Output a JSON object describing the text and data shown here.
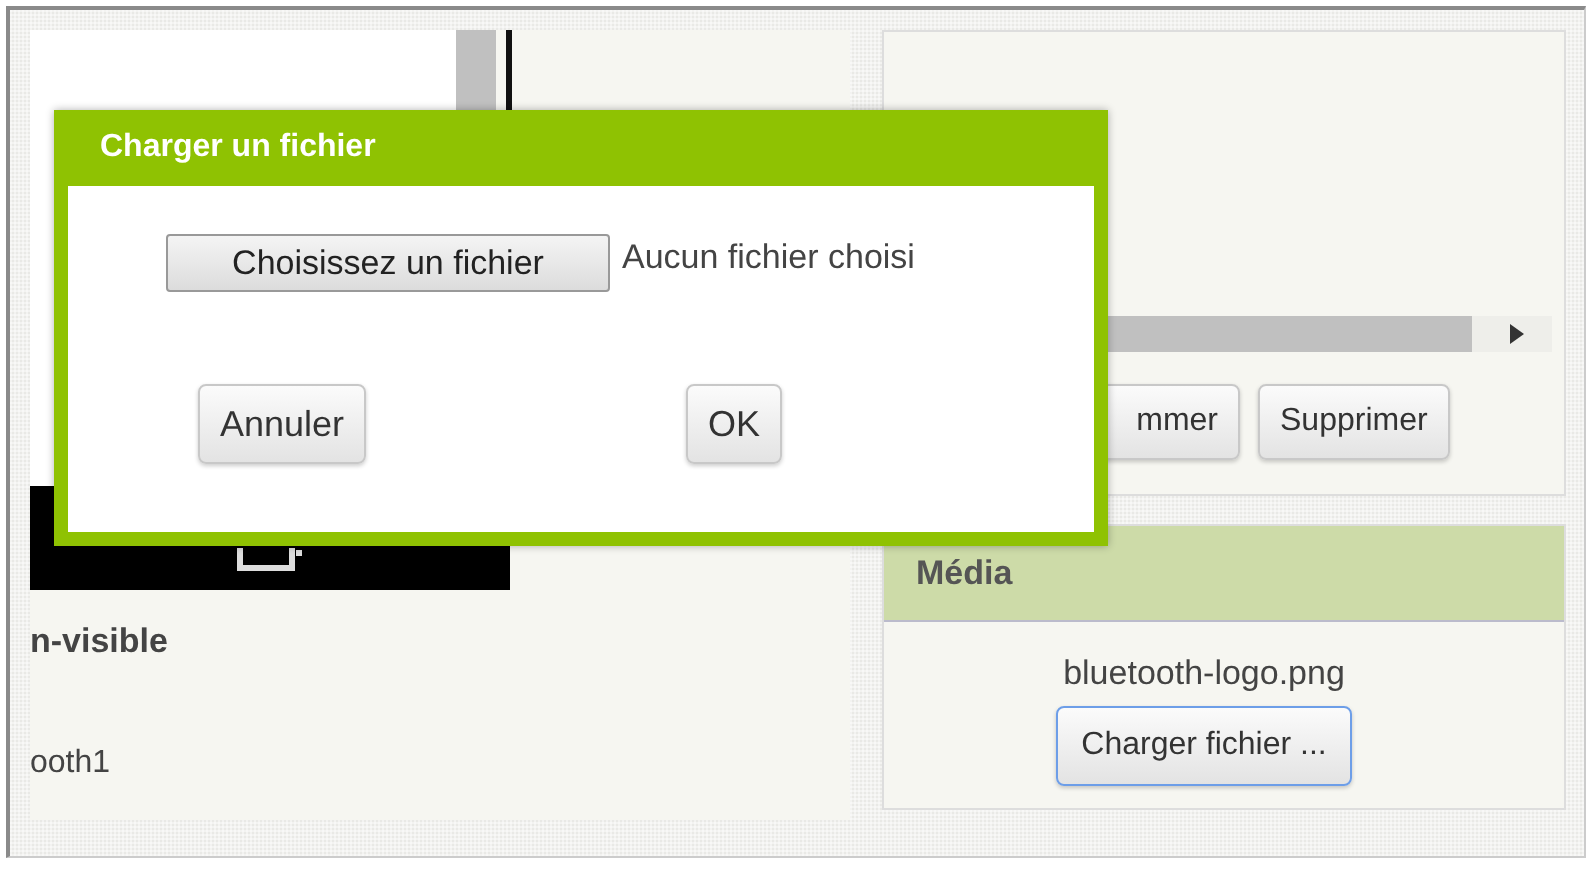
{
  "dialog": {
    "title": "Charger un fichier",
    "file_button": "Choisissez un fichier",
    "file_status": "Aucun fichier choisi",
    "buttons": [
      "Annuler",
      "OK"
    ]
  },
  "left_panel": {
    "section_title": "n-visible",
    "component": "ooth1"
  },
  "top_panel": {
    "buttons": [
      "mmer",
      "Supprimer"
    ]
  },
  "media": {
    "title": "Média",
    "files": [
      "bluetooth-logo.png"
    ],
    "upload_button": "Charger fichier ..."
  }
}
